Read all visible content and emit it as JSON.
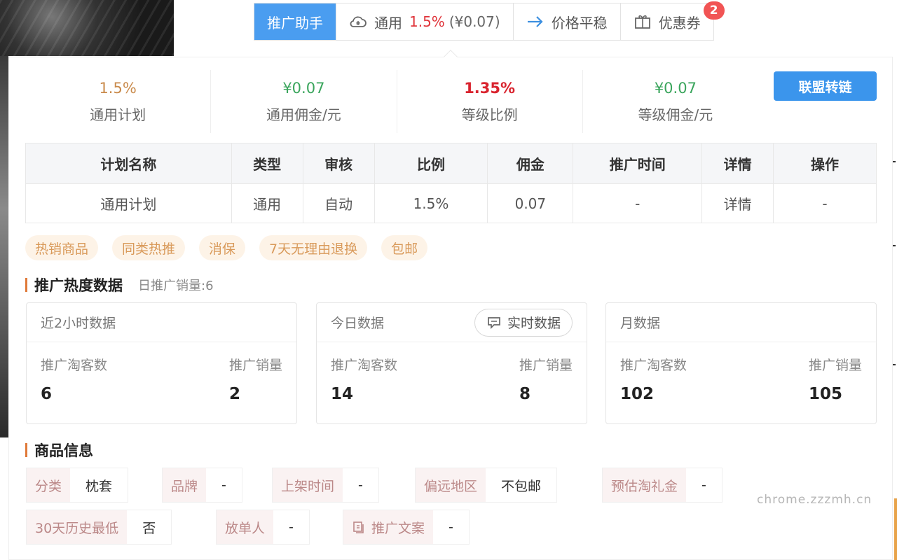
{
  "toolbar": {
    "assistant": "推广助手",
    "general_label": "通用",
    "general_rate": "1.5%",
    "general_money": "(¥0.07)",
    "price_label": "价格平稳",
    "coupon_label": "优惠券",
    "coupon_badge": "2"
  },
  "stats": [
    {
      "value": "1.5%",
      "label": "通用计划",
      "color": "#c98a4b"
    },
    {
      "value": "¥0.07",
      "label": "通用佣金/元",
      "color": "#3aa55c"
    },
    {
      "value": "1.35%",
      "label": "等级比例",
      "color": "#d9232e"
    },
    {
      "value": "¥0.07",
      "label": "等级佣金/元",
      "color": "#3aa55c"
    }
  ],
  "union_button": "联盟转链",
  "plan_table": {
    "headers": [
      "计划名称",
      "类型",
      "审核",
      "比例",
      "佣金",
      "推广时间",
      "详情",
      "操作"
    ],
    "rows": [
      [
        "通用计划",
        "通用",
        "自动",
        "1.5%",
        "0.07",
        "-",
        "详情",
        "-"
      ]
    ]
  },
  "tags": [
    "热销商品",
    "同类热推",
    "消保",
    "7天无理由退换",
    "包邮"
  ],
  "promo_section": {
    "title": "推广热度数据",
    "subtitle": "日推广销量:6"
  },
  "cards": [
    {
      "title": "近2小时数据",
      "left_label": "推广淘客数",
      "left_value": "6",
      "right_label": "推广销量",
      "right_value": "2"
    },
    {
      "title": "今日数据",
      "button": "实时数据",
      "left_label": "推广淘客数",
      "left_value": "14",
      "right_label": "推广销量",
      "right_value": "8"
    },
    {
      "title": "月数据",
      "left_label": "推广淘客数",
      "left_value": "102",
      "right_label": "推广销量",
      "right_value": "105"
    }
  ],
  "product_section": {
    "title": "商品信息"
  },
  "product_info": [
    {
      "key": "分类",
      "value": "枕套"
    },
    {
      "key": "品牌",
      "value": "-"
    },
    {
      "key": "上架时间",
      "value": "-"
    },
    {
      "key": "偏远地区",
      "value": "不包邮"
    },
    {
      "key": "预估淘礼金",
      "value": "-"
    },
    {
      "key": "30天历史最低",
      "value": "否"
    },
    {
      "key": "放单人",
      "value": "-"
    },
    {
      "key": "推广文案",
      "value": "-"
    }
  ],
  "watermark": "chrome.zzzmh.cn",
  "colors": {
    "primary": "#4a9df0",
    "button_blue": "#3b95ec",
    "rate_red": "#e0343a",
    "tag_bg": "#fdf3e7",
    "tag_text": "#d99a5a",
    "section_bar": "#e07a3a"
  }
}
